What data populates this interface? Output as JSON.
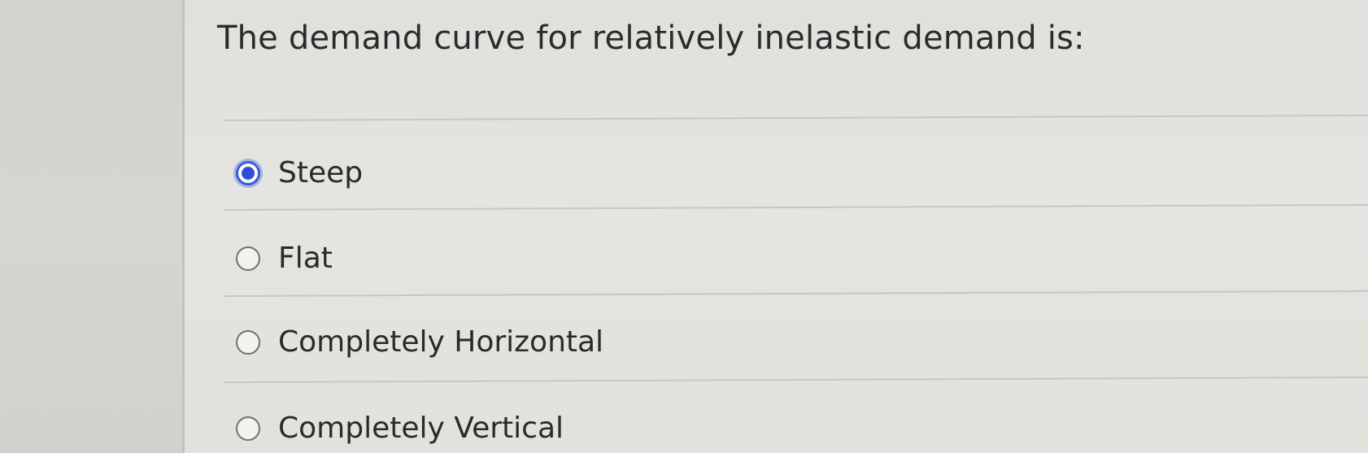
{
  "question": {
    "text": "The demand curve for relatively inelastic demand is:"
  },
  "options": [
    {
      "label": "Steep",
      "selected": true
    },
    {
      "label": "Flat",
      "selected": false
    },
    {
      "label": "Completely Horizontal",
      "selected": false
    },
    {
      "label": "Completely Vertical",
      "selected": false
    }
  ],
  "colors": {
    "accent": "#2d4fd4",
    "text": "#2b2b2b",
    "background": "#e2e2dd"
  }
}
